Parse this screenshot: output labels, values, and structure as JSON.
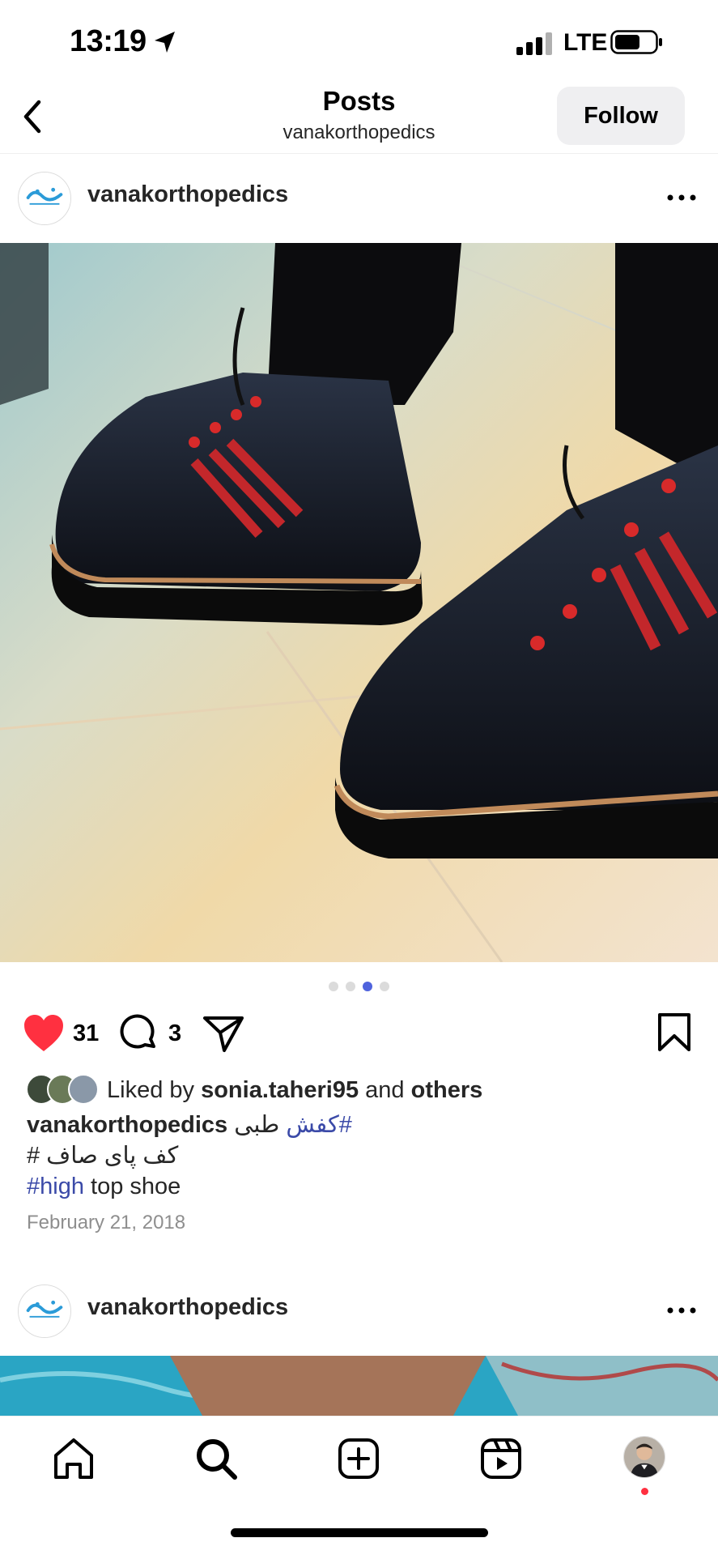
{
  "status_bar": {
    "time": "13:19",
    "network": "LTE"
  },
  "header": {
    "title": "Posts",
    "subtitle": "vanakorthopedics",
    "follow_label": "Follow"
  },
  "posts": [
    {
      "username": "vanakorthopedics",
      "carousel": {
        "count": 4,
        "active_index": 2
      },
      "likes": "31",
      "comments": "3",
      "liked_by": {
        "prefix": "Liked by",
        "user": "sonia.taheri95",
        "joiner": "and",
        "others": "others"
      },
      "caption": {
        "author": "vanakorthopedics",
        "line1_tag": "#کفش",
        "line1_text": "طبی",
        "line2": "کف پای صاف #",
        "line3_tag": "#high",
        "line3_text": "top shoe"
      },
      "date": "February 21, 2018"
    },
    {
      "username": "vanakorthopedics"
    }
  ],
  "tab_bar": {
    "tabs": [
      "home",
      "search",
      "create",
      "reels",
      "profile"
    ],
    "active": "search"
  },
  "colors": {
    "like_red": "#ff3040",
    "hashtag": "#3b4aa8",
    "dot_active": "#4f63dd",
    "follow_bg": "#efeff1"
  },
  "icons": [
    "location-arrow-icon",
    "cellular-signal-icon",
    "battery-icon",
    "back-chevron-icon",
    "more-dots-icon",
    "heart-icon",
    "comment-icon",
    "share-icon",
    "bookmark-icon",
    "home-icon",
    "search-icon",
    "create-icon",
    "reels-icon"
  ]
}
